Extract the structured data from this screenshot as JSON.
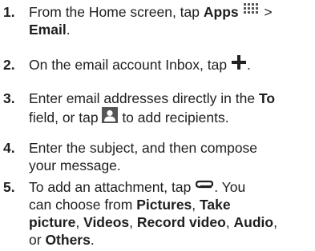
{
  "steps": [
    {
      "number": "1.",
      "line1_prefix": "From the Home screen, tap ",
      "apps_label": "Apps",
      "apps_icon": "apps-grid-icon",
      "separator": " >",
      "email_label": "Email",
      "line2_suffix": "."
    },
    {
      "number": "2.",
      "text_prefix": "On the email account Inbox, tap ",
      "compose_icon": "plus-icon",
      "text_suffix": "."
    },
    {
      "number": "3.",
      "line1_prefix": "Enter email addresses directly in the ",
      "to_label": "To",
      "line2_prefix": "field, or tap ",
      "contacts_icon": "contact-icon",
      "line2_suffix": " to add recipients."
    },
    {
      "number": "4.",
      "line1": "Enter the subject, and then compose",
      "line2": "your message."
    },
    {
      "number": "5.",
      "line1_prefix": "To add an attachment, tap ",
      "attach_icon": "paperclip-icon",
      "line1_suffix": ". You",
      "line2_prefix": "can choose from ",
      "opt_pictures": "Pictures",
      "comma1": ", ",
      "opt_take": "Take",
      "opt_picture": "picture",
      "comma2": ", ",
      "opt_videos": "Videos",
      "comma3": ", ",
      "opt_record": "Record video",
      "comma4": ", ",
      "opt_audio": "Audio",
      "comma5": ",",
      "line4_prefix": "or ",
      "opt_others": "Others",
      "line4_suffix": "."
    }
  ],
  "colors": {
    "text": "#1e1e1e",
    "icon_gray": "#555555",
    "icon_dark": "#222222"
  }
}
